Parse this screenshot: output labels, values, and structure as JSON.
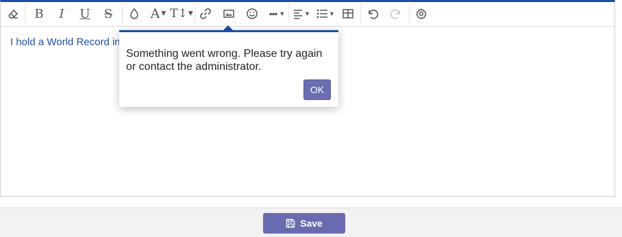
{
  "editor": {
    "content_text": "I hold a World Record in"
  },
  "toolbar": {
    "items": [
      {
        "name": "eraser-icon",
        "label": "Clear formatting"
      },
      {
        "name": "bold-icon",
        "label": "B"
      },
      {
        "name": "italic-icon",
        "label": "I"
      },
      {
        "name": "underline-icon",
        "label": "U"
      },
      {
        "name": "strikethrough-icon",
        "label": "S"
      },
      {
        "name": "color-drop-icon",
        "label": "Color"
      },
      {
        "name": "font-icon",
        "label": "A"
      },
      {
        "name": "font-size-icon",
        "label": "TT"
      },
      {
        "name": "link-icon",
        "label": "Link"
      },
      {
        "name": "image-icon",
        "label": "Image"
      },
      {
        "name": "emoji-icon",
        "label": "Emoji"
      },
      {
        "name": "more-icon",
        "label": "More"
      },
      {
        "name": "align-icon",
        "label": "Align"
      },
      {
        "name": "list-icon",
        "label": "List"
      },
      {
        "name": "table-icon",
        "label": "Table"
      },
      {
        "name": "undo-icon",
        "label": "Undo"
      },
      {
        "name": "redo-icon",
        "label": "Redo"
      },
      {
        "name": "settings-icon",
        "label": "Settings"
      }
    ]
  },
  "popup": {
    "message": "Something went wrong. Please try again or contact the administrator.",
    "ok_label": "OK"
  },
  "footer": {
    "save_label": "Save"
  },
  "colors": {
    "accent": "#1c4ea7",
    "button": "#6a6ab0",
    "text_link": "#1f4f9f"
  }
}
